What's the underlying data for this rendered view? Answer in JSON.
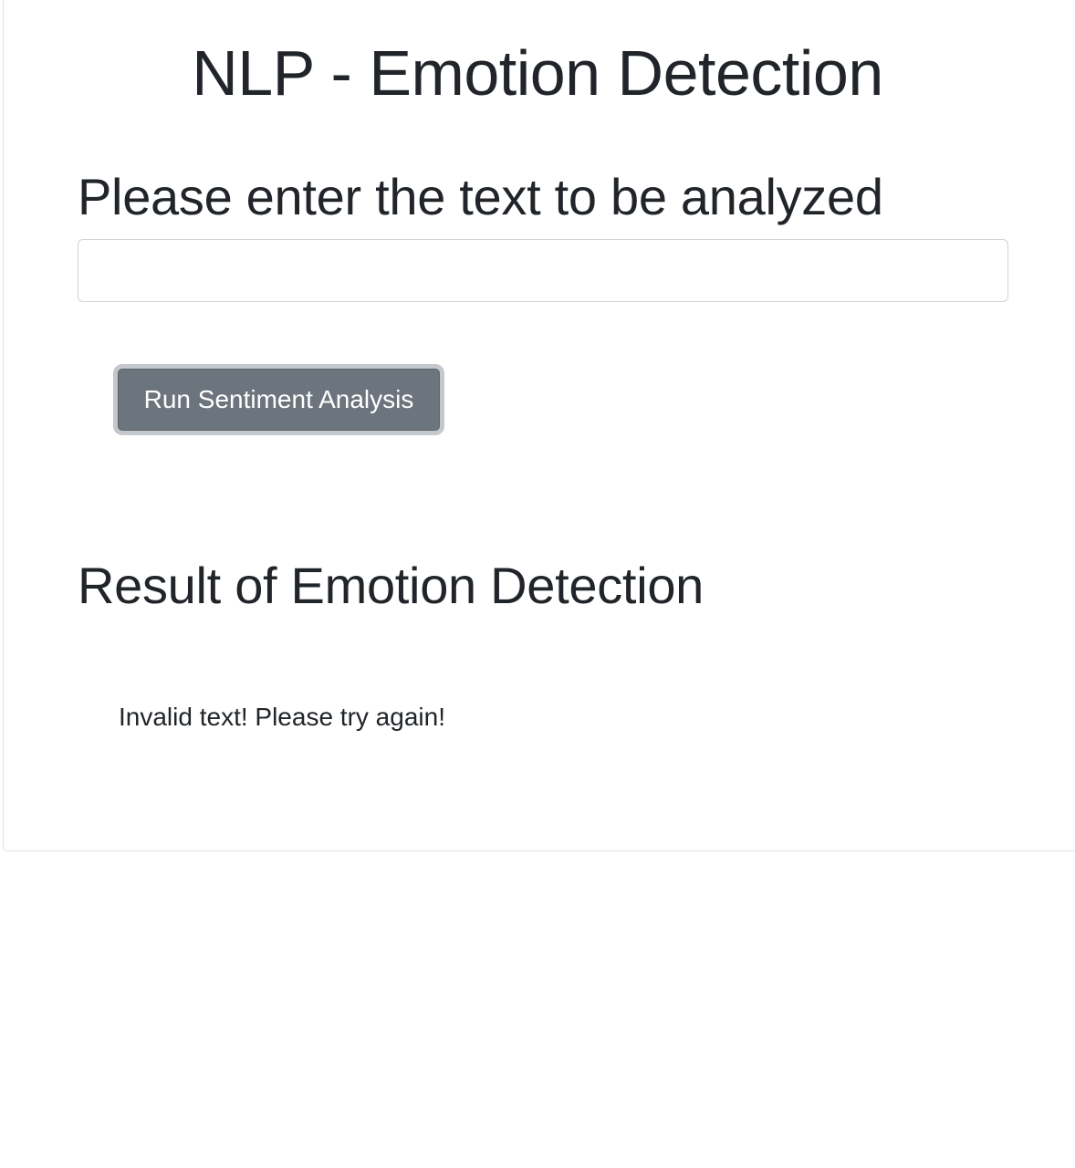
{
  "page": {
    "title": "NLP - Emotion Detection"
  },
  "form": {
    "prompt_heading": "Please enter the text to be analyzed",
    "text_input_value": "",
    "text_input_placeholder": "",
    "run_button_label": "Run Sentiment Analysis"
  },
  "result": {
    "heading": "Result of Emotion Detection",
    "message": "Invalid text! Please try again!"
  },
  "colors": {
    "text": "#212529",
    "button_background": "#6c757d",
    "button_focus_ring": "#c4c7cb",
    "input_border": "#ced4da",
    "card_border": "#dee2e6",
    "background": "#ffffff"
  }
}
